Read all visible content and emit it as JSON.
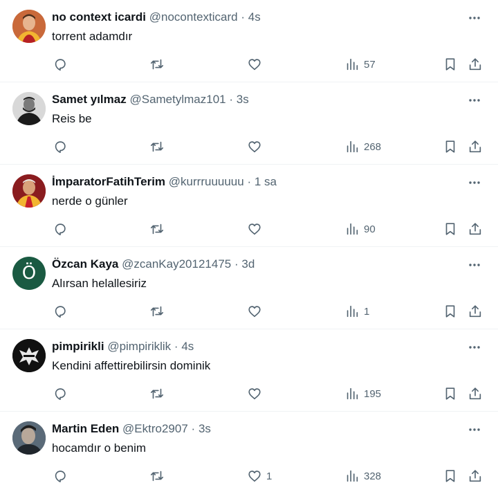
{
  "tweets": [
    {
      "name": "no context icardi",
      "handle": "@nocontexticard",
      "time": "4s",
      "text": "torrent adamdır",
      "replies": "",
      "retweets": "",
      "likes": "",
      "views": "57",
      "avatar": {
        "kind": "photo",
        "bg": "#c9693a"
      }
    },
    {
      "name": "Samet yılmaz",
      "handle": "@Sametylmaz101",
      "time": "3s",
      "text": "Reis be",
      "replies": "",
      "retweets": "",
      "likes": "",
      "views": "268",
      "avatar": {
        "kind": "photo",
        "bg": "#2b2b2b"
      }
    },
    {
      "name": "İmparatorFatihTerim",
      "handle": "@kurrruuuuuu",
      "time": "1 sa",
      "text": "nerde o günler",
      "replies": "",
      "retweets": "",
      "likes": "",
      "views": "90",
      "avatar": {
        "kind": "photo",
        "bg": "#b5262a"
      }
    },
    {
      "name": "Özcan Kaya",
      "handle": "@zcanKay20121475",
      "time": "3d",
      "text": "Alırsan helallesiriz",
      "replies": "",
      "retweets": "",
      "likes": "",
      "views": "1",
      "avatar": {
        "kind": "letter",
        "letter": "Ö",
        "bg": "#1a5a42"
      }
    },
    {
      "name": "pimpirikli",
      "handle": "@pimpiriklik",
      "time": "4s",
      "text": "Kendini affettirebilirsin dominik",
      "replies": "",
      "retweets": "",
      "likes": "",
      "views": "195",
      "avatar": {
        "kind": "photo",
        "bg": "#111111"
      }
    },
    {
      "name": "Martin Eden",
      "handle": "@Ektro2907",
      "time": "3s",
      "text": "hocamdır o benim",
      "replies": "",
      "retweets": "",
      "likes": "1",
      "views": "328",
      "avatar": {
        "kind": "photo",
        "bg": "#3a4a5a"
      }
    }
  ],
  "separator": "·",
  "colors": {
    "text": "#0f1419",
    "muted": "#536471",
    "divider": "#eff3f4"
  }
}
